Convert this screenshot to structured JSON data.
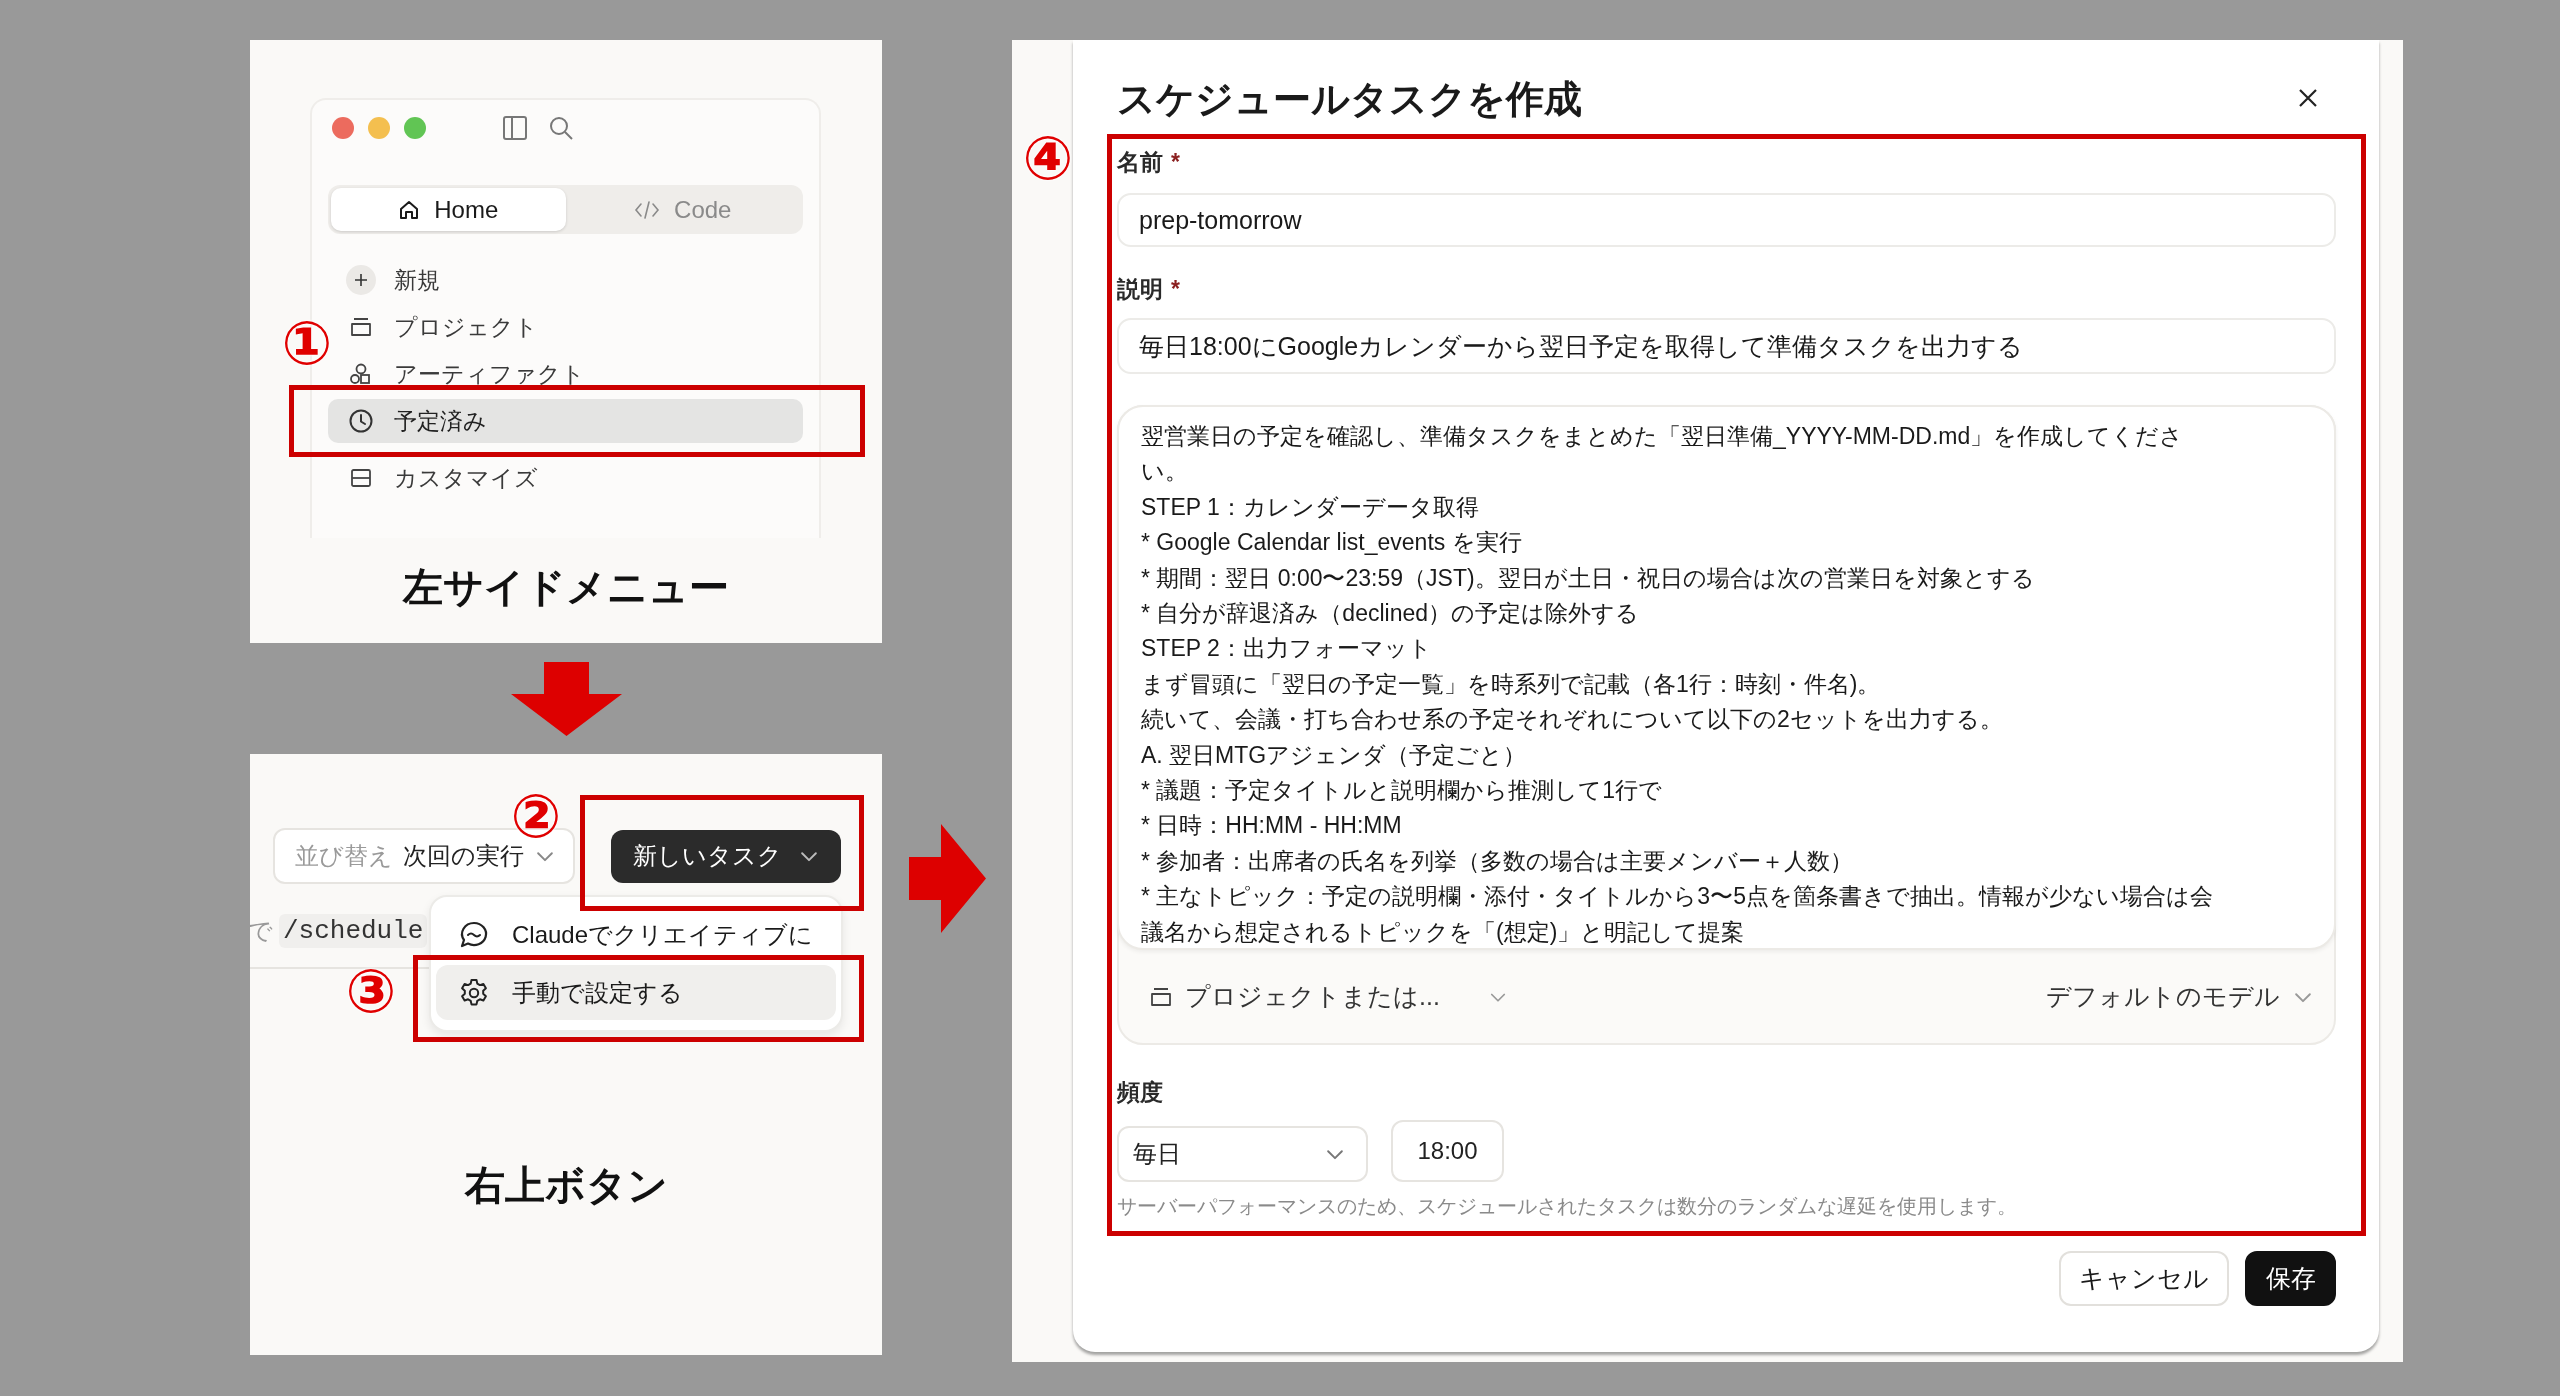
{
  "sidebar_panel": {
    "tabs": [
      {
        "label": "Home",
        "selected": true
      },
      {
        "label": "Code",
        "selected": false
      }
    ],
    "items": [
      {
        "label": "新規",
        "kind": "new",
        "selected": false
      },
      {
        "label": "プロジェクト",
        "kind": "project",
        "selected": false
      },
      {
        "label": "アーティファクト",
        "kind": "artifact",
        "selected": false
      },
      {
        "label": "予定済み",
        "kind": "scheduled",
        "selected": true
      },
      {
        "label": "カスタマイズ",
        "kind": "customize",
        "selected": false
      }
    ],
    "step": "①",
    "caption": "左サイドメニュー"
  },
  "button_panel": {
    "sort": {
      "label": "並び替え",
      "value": "次回の実行"
    },
    "new_task_button": "新しいタスク",
    "hint": {
      "before": "で",
      "code": "/schedule"
    },
    "menu": [
      {
        "label": "Claudeでクリエイティブに",
        "kind": "chat",
        "selected": false
      },
      {
        "label": "手動で設定する",
        "kind": "settings",
        "selected": true
      }
    ],
    "steps": [
      "②",
      "③"
    ],
    "caption": "右上ボタン"
  },
  "dialog": {
    "title": "スケジュールタスクを作成",
    "step": "④",
    "fields": [
      {
        "label": "名前",
        "mark": "*",
        "value": "prep-tomorrow"
      },
      {
        "label": "説明",
        "mark": "*",
        "value": "毎日18:00にGoogleカレンダーから翌日予定を取得して準備タスクを出力する"
      }
    ],
    "prompt": [
      "翌営業日の予定を確認し、準備タスクをまとめた「翌日準備_YYYY-MM-DD.md」を作成してくださ",
      "い。",
      "STEP 1：カレンダーデータ取得",
      "* Google Calendar list_events を実行",
      "* 期間：翌日 0:00〜23:59（JST)。翌日が土日・祝日の場合は次の営業日を対象とする",
      "* 自分が辞退済み（declined）の予定は除外する",
      "STEP 2：出力フォーマット",
      "まず冒頭に「翌日の予定一覧」を時系列で記載（各1行：時刻・件名)。",
      "続いて、会議・打ち合わせ系の予定それぞれについて以下の2セットを出力する。",
      "A. 翌日MTGアジェンダ（予定ごと）",
      "* 議題：予定タイトルと説明欄から推測して1行で",
      "* 日時：HH:MM - HH:MM",
      "* 参加者：出席者の氏名を列挙（多数の場合は主要メンバー＋人数）",
      "* 主なトピック：予定の説明欄・添付・タイトルから3〜5点を箇条書きで抽出。情報が少ない場合は会",
      "議名から想定されるトピックを「(想定)」と明記して提案"
    ],
    "project_picker": "プロジェクトまたは...",
    "model_picker": "デフォルトのモデル",
    "frequency": {
      "label": "頻度",
      "value": "毎日",
      "time": "18:00",
      "note": "サーバーパフォーマンスのため、スケジュールされたタスクは数分のランダムな遅延を使用します。"
    },
    "buttons": [
      {
        "label": "キャンセル",
        "kind": "secondary"
      },
      {
        "label": "保存",
        "kind": "primary"
      }
    ]
  }
}
